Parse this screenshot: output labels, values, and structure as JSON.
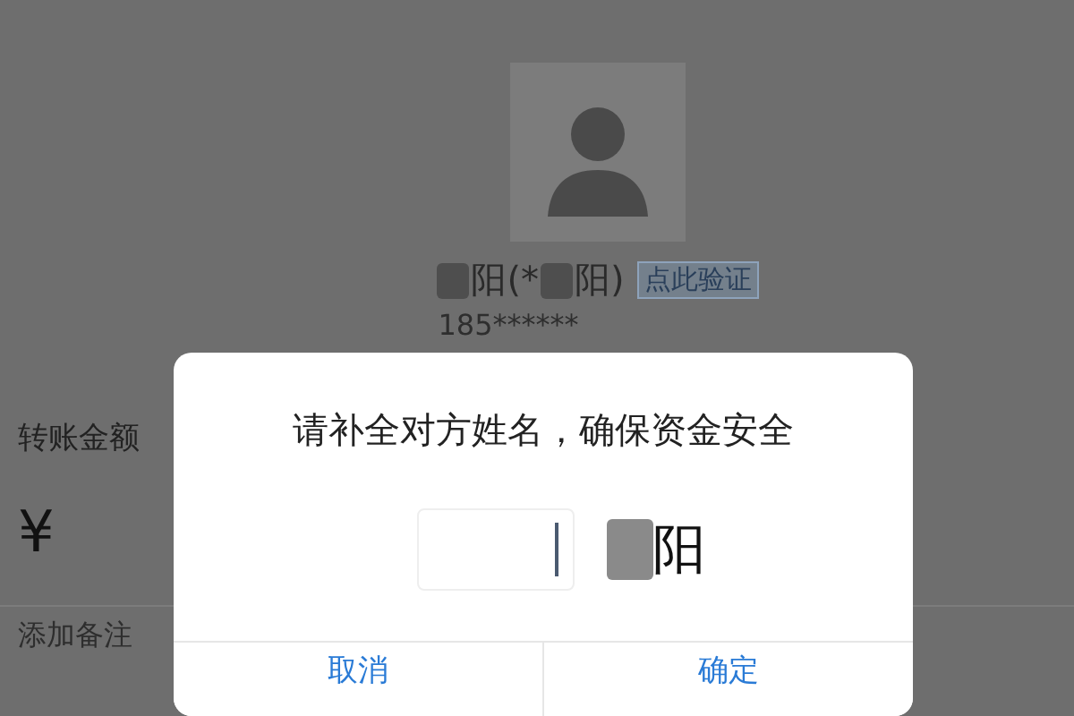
{
  "recipient": {
    "name_segments": [
      {
        "kind": "mosaic"
      },
      {
        "kind": "text",
        "text": "阳(*"
      },
      {
        "kind": "mosaic"
      },
      {
        "kind": "text",
        "text": "阳)"
      }
    ],
    "verify_link": "点此验证",
    "phone": "185******"
  },
  "amount_label": "转账金额",
  "currency": "¥",
  "note_field": {
    "placeholder": "添加备注"
  },
  "dialog": {
    "title": "请补全对方姓名，确保资金安全",
    "name_suffix": "阳",
    "buttons": [
      {
        "label": "取消"
      },
      {
        "label": "确定"
      }
    ]
  }
}
